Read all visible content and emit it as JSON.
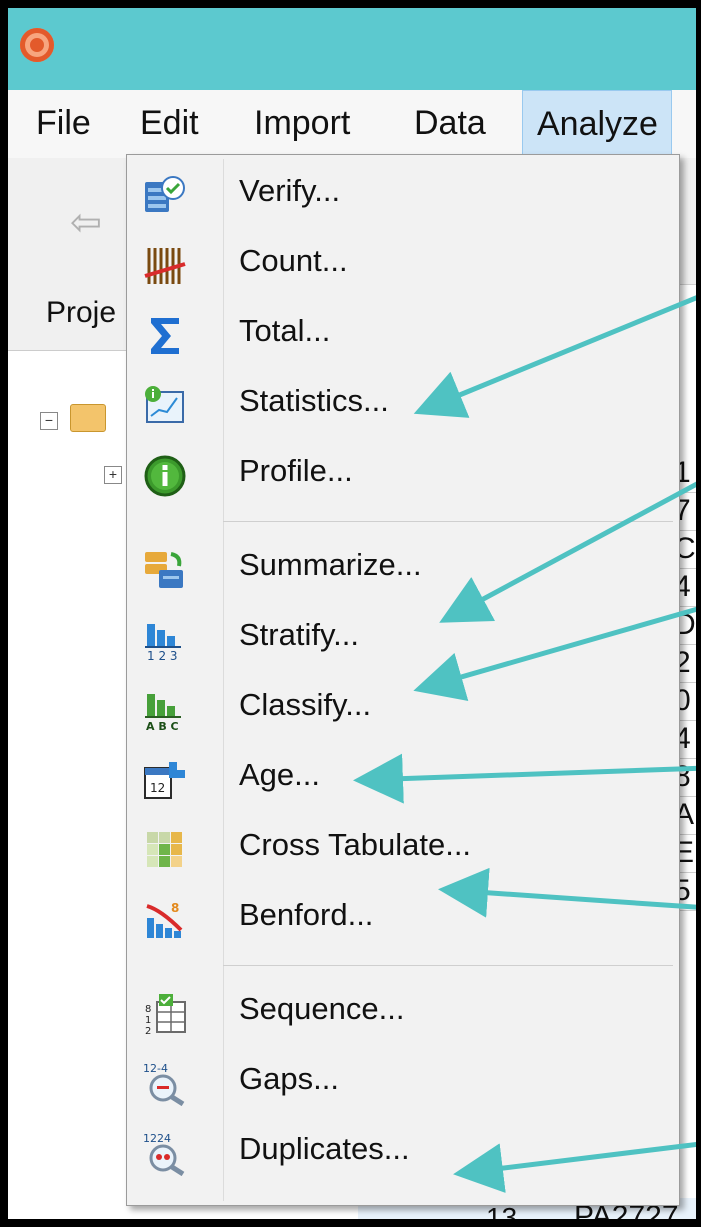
{
  "window": {
    "logo_icon": "app-logo-icon",
    "titlebar_color": "#5cc9cf"
  },
  "menubar": {
    "items": [
      {
        "label": "File"
      },
      {
        "label": "Edit"
      },
      {
        "label": "Import"
      },
      {
        "label": "Data"
      },
      {
        "label": "Analyze"
      }
    ],
    "active_item": "Analyze"
  },
  "panel": {
    "tab_label": "Proje"
  },
  "grid_partial": {
    "fragments": [
      "1",
      "7",
      "C",
      "4",
      "D",
      "2",
      "0",
      "4",
      "8",
      "A",
      "E",
      "5"
    ],
    "bottom_row_number": "13",
    "bottom_row_value": "PA2727"
  },
  "analyze_menu": {
    "items": [
      {
        "label": "Verify...",
        "icon": "verify-icon"
      },
      {
        "label": "Count...",
        "icon": "count-icon"
      },
      {
        "label": "Total...",
        "icon": "sigma-icon"
      },
      {
        "label": "Statistics...",
        "icon": "statistics-icon"
      },
      {
        "label": "Profile...",
        "icon": "profile-icon"
      },
      {
        "label": "Summarize...",
        "icon": "summarize-icon"
      },
      {
        "label": "Stratify...",
        "icon": "stratify-icon"
      },
      {
        "label": "Classify...",
        "icon": "classify-icon"
      },
      {
        "label": "Age...",
        "icon": "age-icon"
      },
      {
        "label": "Cross Tabulate...",
        "icon": "cross-tabulate-icon"
      },
      {
        "label": "Benford...",
        "icon": "benford-icon"
      },
      {
        "label": "Sequence...",
        "icon": "sequence-icon"
      },
      {
        "label": "Gaps...",
        "icon": "gaps-icon"
      },
      {
        "label": "Duplicates...",
        "icon": "duplicates-icon"
      }
    ]
  },
  "annotation_arrow_color": "#4fc2c2"
}
